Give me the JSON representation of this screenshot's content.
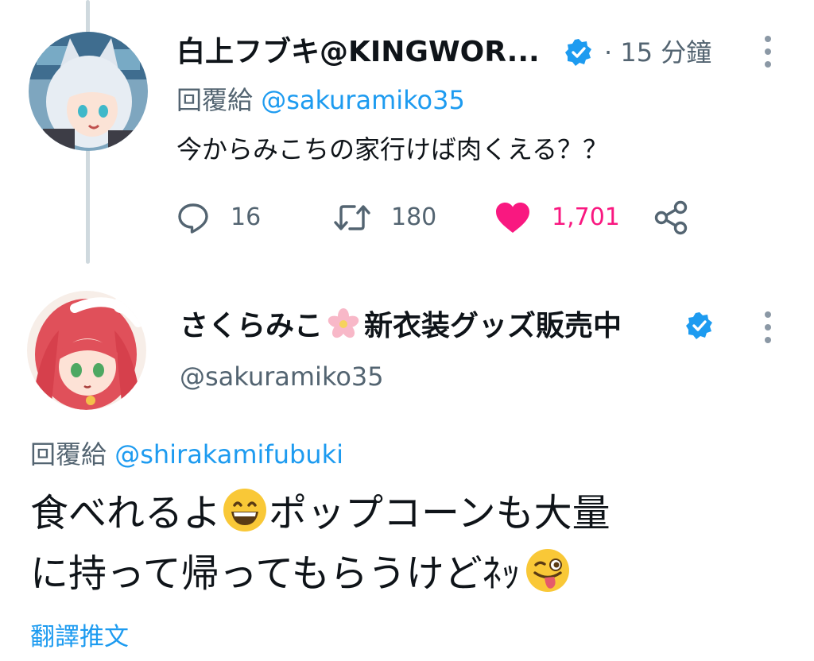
{
  "colors": {
    "text": "#0f1419",
    "secondary": "#536471",
    "accent": "#1d9bf0",
    "like": "#f91880",
    "thread_line": "#cfd9de"
  },
  "tweet1": {
    "display_name": "白上フブキ@KINGWOR...",
    "verified": true,
    "time": "· 15 分鐘",
    "reply_prefix": "回覆給",
    "reply_to": "@sakuramiko35",
    "text": "今からみこちの家行けば肉くえる？？",
    "actions": {
      "reply_icon": "comment-icon",
      "reply_count": "16",
      "retweet_icon": "retweet-icon",
      "retweet_count": "180",
      "like_icon": "heart-filled-icon",
      "like_count": "1,701",
      "liked": true,
      "share_icon": "share-icon"
    }
  },
  "tweet2": {
    "display_name_part1": "さくらみこ",
    "name_emoji": "cherry-blossom-icon",
    "display_name_part2": "新衣装グッズ販売中",
    "verified": true,
    "handle": "@sakuramiko35",
    "reply_prefix": "回覆給",
    "reply_to": "@shirakamifubuki",
    "line1_a": "食べれるよ",
    "line1_emoji": "grinning-face-icon",
    "line1_b": "ポップコーンも大量",
    "line2_a": "に持って帰ってもらうけどﾈｯ",
    "line2_emoji": "winking-tongue-face-icon",
    "translate_label": "翻譯推文"
  }
}
